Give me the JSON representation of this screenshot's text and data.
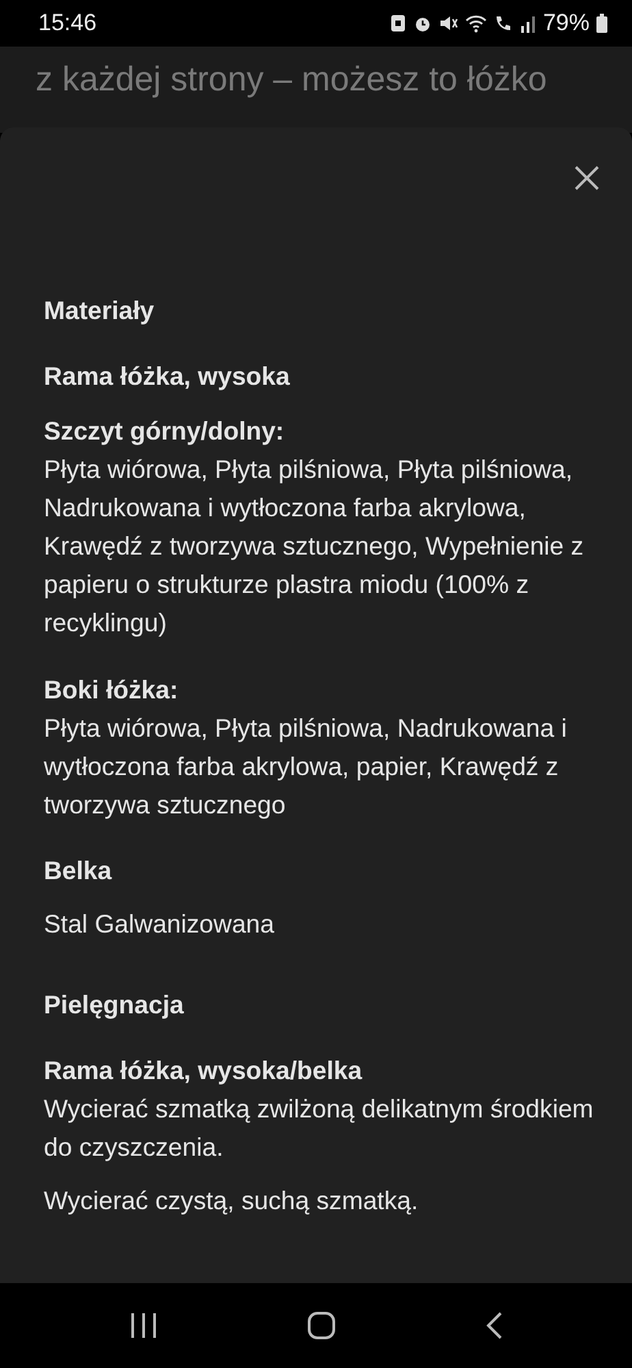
{
  "status_bar": {
    "time": "15:46",
    "battery": "79%"
  },
  "background_text": "z każdej strony – możesz to łóżko",
  "sheet": {
    "blocks": [
      {
        "kind": "section",
        "text": "Materiały"
      },
      {
        "kind": "heading",
        "text": "Rama łóżka, wysoka"
      },
      {
        "kind": "label",
        "text": "Szczyt górny/dolny:"
      },
      {
        "kind": "text",
        "text": "Płyta wiórowa, Płyta pilśniowa, Płyta pilśniowa, Nadrukowana i wytłoczona farba akrylowa, Krawędź z tworzywa sztucznego, Wypełnienie z papieru o strukturze plastra miodu (100% z recyklingu)"
      },
      {
        "kind": "label",
        "text": "Boki łóżka:"
      },
      {
        "kind": "text",
        "text": "Płyta wiórowa, Płyta pilśniowa, Nadrukowana i wytłoczona farba akrylowa, papier, Krawędź z tworzywa sztucznego"
      },
      {
        "kind": "heading",
        "text": "Belka"
      },
      {
        "kind": "text",
        "text": "Stal Galwanizowana"
      },
      {
        "kind": "section",
        "text": "Pielęgnacja"
      },
      {
        "kind": "label",
        "text": "Rama łóżka, wysoka/belka"
      },
      {
        "kind": "text",
        "text": "Wycierać szmatką zwilżoną delikatnym środkiem do czyszczenia."
      },
      {
        "kind": "text",
        "text": "Wycierać czystą, suchą szmatką."
      }
    ]
  }
}
